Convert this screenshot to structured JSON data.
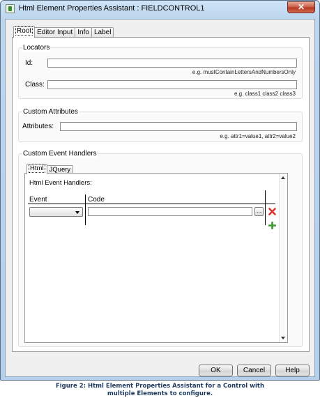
{
  "window": {
    "title": "Html Element Properties Assistant : FIELDCONTROL1",
    "close_glyph": "✕"
  },
  "tabs": [
    "Root",
    "Editor Input",
    "Info",
    "Label"
  ],
  "locators": {
    "title": "Locators",
    "id_label": "Id:",
    "id_value": "",
    "id_hint": "e.g. mustContainLettersAndNumbersOnly",
    "class_label": "Class:",
    "class_value": "",
    "class_hint": "e.g. class1 class2 class3"
  },
  "custom_attributes": {
    "title": "Custom Attributes",
    "attributes_label": "Attributes:",
    "attributes_value": "",
    "attributes_hint": "e.g. attr1=value1, attr2=value2"
  },
  "custom_event_handlers": {
    "title": "Custom Event Handlers",
    "tabs": [
      "Html",
      "JQuery"
    ],
    "section_label": "Html Event Handlers:",
    "columns": [
      "Event",
      "Code"
    ],
    "row": {
      "event": "",
      "code": "",
      "browse_label": "..."
    }
  },
  "buttons": {
    "ok": "OK",
    "cancel": "Cancel",
    "help": "Help"
  },
  "caption": {
    "line1": "Figure 2: Html Element Properties Assistant for a Control with",
    "line2": "multiple Elements to configure."
  },
  "colors": {
    "delete_icon": "#d8322b",
    "add_icon": "#3a9a2c",
    "caption_text": "#1f3a5f"
  }
}
